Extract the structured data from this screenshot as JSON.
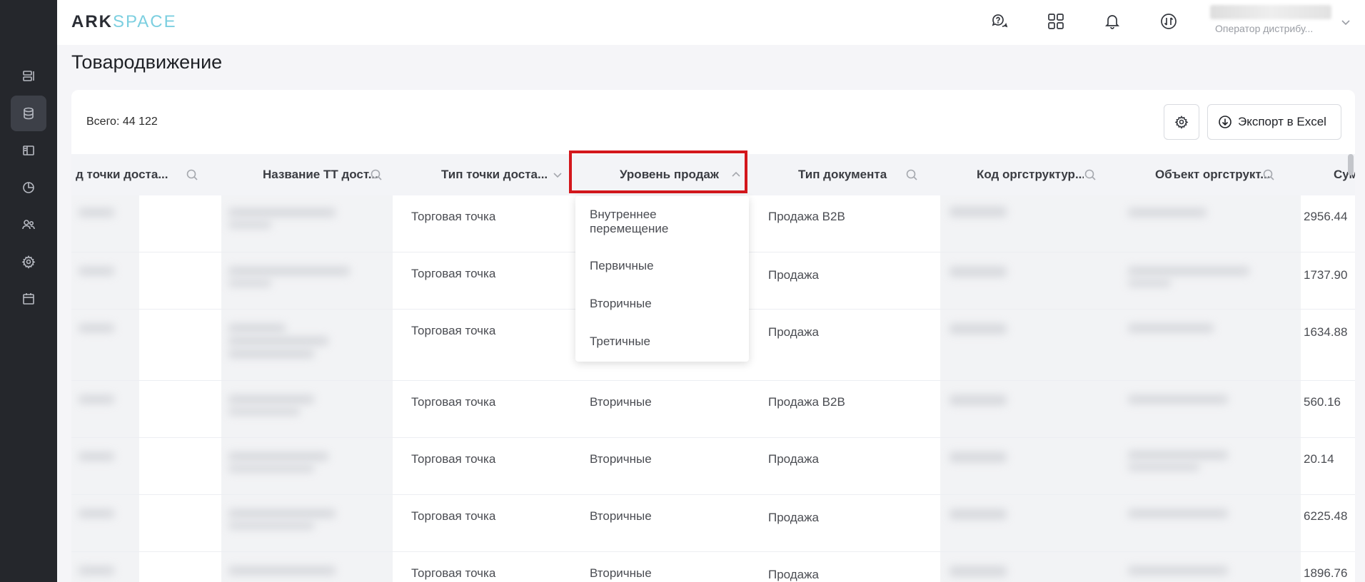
{
  "app": {
    "logo_part1": "ARK",
    "logo_part2": "SPACE",
    "user_role": "Оператор дистрибу..."
  },
  "sidebar": {
    "items": [
      {
        "icon": "reports-list-icon",
        "active": false
      },
      {
        "icon": "database-icon",
        "active": true
      },
      {
        "icon": "layout-panel-icon",
        "active": false
      },
      {
        "icon": "pie-chart-icon",
        "active": false
      },
      {
        "icon": "users-icon",
        "active": false
      },
      {
        "icon": "gear-icon",
        "active": false
      },
      {
        "icon": "calendar-icon",
        "active": false
      }
    ]
  },
  "topbar_icons": [
    "help-chat-icon",
    "apps-grid-icon",
    "bell-icon",
    "sync-icon"
  ],
  "page": {
    "title": "Товародвижение",
    "total": "Всего: 44 122",
    "export_label": "Экспорт в Excel"
  },
  "table": {
    "columns": [
      "д точки доста...",
      "Название ТТ дост...",
      "Тип точки доста...",
      "Уровень продаж",
      "Тип документа",
      "Код оргструктур...",
      "Объект оргструкт...",
      "Сумма с"
    ],
    "rows": [
      {
        "type": "Торговая точка",
        "level": "",
        "doc": "Продажа B2B",
        "sum": "2956.44"
      },
      {
        "type": "Торговая точка",
        "level": "",
        "doc": "Продажа",
        "sum": "1737.90"
      },
      {
        "type": "Торговая точка",
        "level": "",
        "doc": "Продажа",
        "sum": "1634.88"
      },
      {
        "type": "Торговая точка",
        "level": "Вторичные",
        "doc": "Продажа B2B",
        "sum": "560.16"
      },
      {
        "type": "Торговая точка",
        "level": "Вторичные",
        "doc": "Продажа",
        "sum": "20.14"
      },
      {
        "type": "Торговая точка",
        "level": "Вторичные",
        "doc": "Продажа",
        "sum": "6225.48"
      },
      {
        "type": "Торговая точка",
        "level": "Вторичные",
        "doc": "Продажа",
        "sum": "1896.76"
      }
    ]
  },
  "dropdown": {
    "options": [
      "Внутреннее перемещение",
      "Первичные",
      "Вторичные",
      "Третичные"
    ]
  },
  "colors": {
    "rail_bg": "#25272c",
    "highlight_border": "#d3171c",
    "logo_accent": "#7ccfe0"
  }
}
